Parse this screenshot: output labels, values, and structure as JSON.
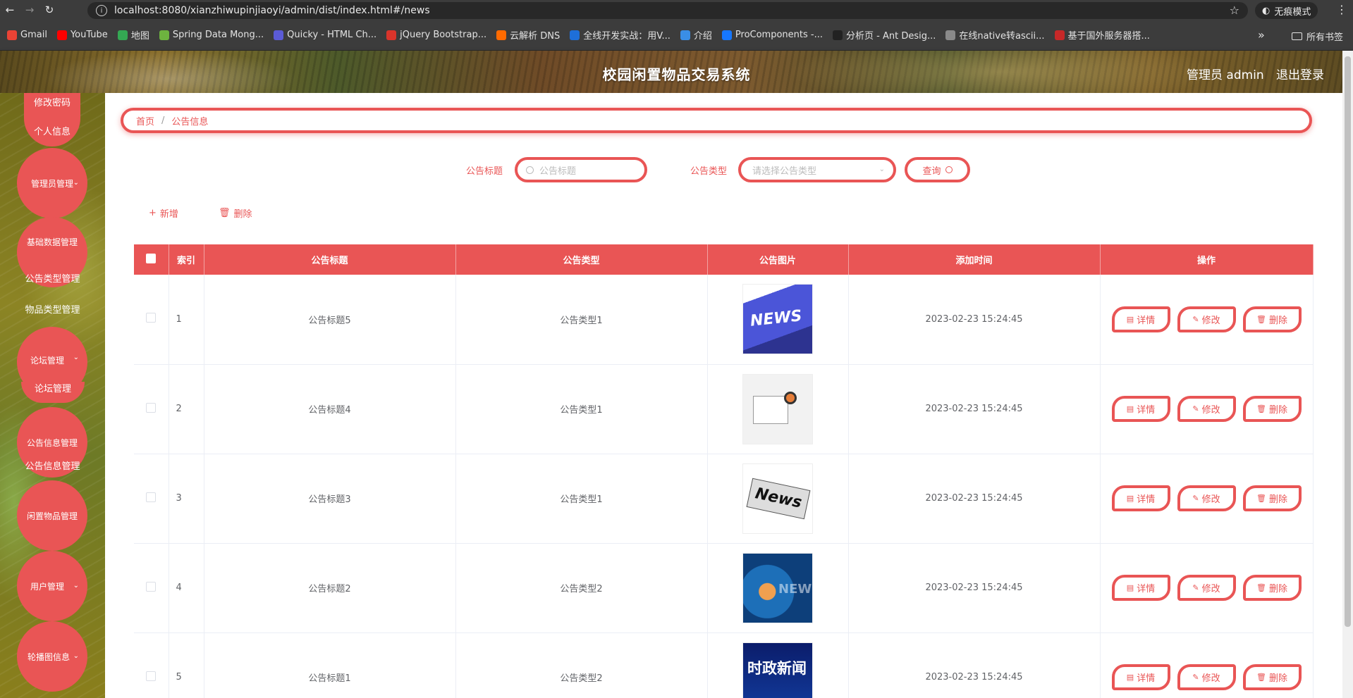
{
  "browser": {
    "url": "localhost:8080/xianzhiwupinjiaoyi/admin/dist/index.html#/news",
    "incognito_label": "无痕模式",
    "bookmarks": [
      {
        "label": "Gmail",
        "color": "#ea4335"
      },
      {
        "label": "YouTube",
        "color": "#ff0000"
      },
      {
        "label": "地图",
        "color": "#34a853"
      },
      {
        "label": "Spring Data Mong...",
        "color": "#6db33f"
      },
      {
        "label": "Quicky - HTML Ch...",
        "color": "#5b5bd6"
      },
      {
        "label": "jQuery Bootstrap...",
        "color": "#d9342b"
      },
      {
        "label": "云解析 DNS",
        "color": "#ff6a00"
      },
      {
        "label": "全线开发实战：用V...",
        "color": "#1e6fd9"
      },
      {
        "label": "介绍",
        "color": "#3a8ee6"
      },
      {
        "label": "ProComponents -...",
        "color": "#1677ff"
      },
      {
        "label": "分析页 - Ant Desig...",
        "color": "#222222"
      },
      {
        "label": "在线native转ascii...",
        "color": "#8a8a8a"
      },
      {
        "label": "基于国外服务器搭...",
        "color": "#c62828"
      }
    ],
    "all_bookmarks": "所有书签"
  },
  "header": {
    "title": "校园闲置物品交易系统",
    "admin": "管理员 admin",
    "logout": "退出登录"
  },
  "sidebar": {
    "top_items": [
      "修改密码",
      "个人信息"
    ],
    "menus": [
      {
        "label": "管理员管理",
        "subs": []
      },
      {
        "label": "基础数据管理",
        "subs": [
          "公告类型管理",
          "物品类型管理"
        ]
      },
      {
        "label": "论坛管理",
        "subs": [
          "论坛管理"
        ]
      },
      {
        "label": "公告信息管理",
        "subs": [
          "公告信息管理"
        ]
      },
      {
        "label": "闲置物品管理",
        "subs": []
      },
      {
        "label": "用户管理",
        "subs": []
      },
      {
        "label": "轮播图信息",
        "subs": []
      }
    ]
  },
  "breadcrumb": {
    "home": "首页",
    "current": "公告信息"
  },
  "search": {
    "title_label": "公告标题",
    "title_placeholder": "公告标题",
    "type_label": "公告类型",
    "type_placeholder": "请选择公告类型",
    "query_label": "查询"
  },
  "actions": {
    "add": "新增",
    "delete": "删除"
  },
  "table": {
    "headers": [
      "索引",
      "公告标题",
      "公告类型",
      "公告图片",
      "添加时间",
      "操作"
    ],
    "op_labels": {
      "detail": "详情",
      "edit": "修改",
      "delete": "删除"
    },
    "rows": [
      {
        "index": "1",
        "title": "公告标题5",
        "type": "公告类型1",
        "image": "news-key-image",
        "time": "2023-02-23 15:24:45"
      },
      {
        "index": "2",
        "title": "公告标题4",
        "type": "公告类型1",
        "image": "news-paper-illustration",
        "time": "2023-02-23 15:24:45"
      },
      {
        "index": "3",
        "title": "公告标题3",
        "type": "公告类型1",
        "image": "newspaper-roll-image",
        "time": "2023-02-23 15:24:45"
      },
      {
        "index": "4",
        "title": "公告标题2",
        "type": "公告类型2",
        "image": "news-globe-image",
        "time": "2023-02-23 15:24:45"
      },
      {
        "index": "5",
        "title": "公告标题1",
        "type": "公告类型2",
        "image": "current-affairs-news-image",
        "image_text": "时政新闻",
        "time": "2023-02-23 15:24:45"
      }
    ]
  },
  "colors": {
    "accent": "#e95555"
  }
}
